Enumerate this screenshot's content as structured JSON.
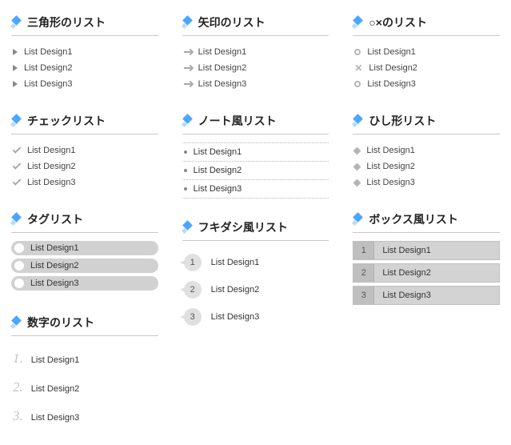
{
  "col1": {
    "triangle": {
      "title": "三角形のリスト",
      "items": [
        "List Design1",
        "List Design2",
        "List Design3"
      ]
    },
    "check": {
      "title": "チェックリスト",
      "items": [
        "List Design1",
        "List Design2",
        "List Design3"
      ]
    },
    "tag": {
      "title": "タグリスト",
      "items": [
        "List Design1",
        "List Design2",
        "List Design3"
      ]
    },
    "number": {
      "title": "数字のリスト",
      "items": [
        "List Design1",
        "List Design2",
        "List Design3"
      ],
      "nums": [
        "1.",
        "2.",
        "3."
      ]
    }
  },
  "col2": {
    "arrow": {
      "title": "矢印のリスト",
      "items": [
        "List Design1",
        "List Design2",
        "List Design3"
      ]
    },
    "note": {
      "title": "ノート風リスト",
      "items": [
        "List Design1",
        "List Design2",
        "List Design3"
      ]
    },
    "bubble": {
      "title": "フキダシ風リスト",
      "items": [
        "List Design1",
        "List Design2",
        "List Design3"
      ],
      "nums": [
        "1",
        "2",
        "3"
      ]
    }
  },
  "col3": {
    "ox": {
      "title": "○×のリスト",
      "items": [
        "List Design1",
        "List Design2",
        "List Design3"
      ],
      "marks": [
        "o",
        "x",
        "o"
      ]
    },
    "diamond": {
      "title": "ひし形リスト",
      "items": [
        "List Design1",
        "List Design2",
        "List Design3"
      ]
    },
    "box": {
      "title": "ボックス風リスト",
      "items": [
        "List Design1",
        "List Design2",
        "List Design3"
      ],
      "nums": [
        "1",
        "2",
        "3"
      ]
    }
  }
}
